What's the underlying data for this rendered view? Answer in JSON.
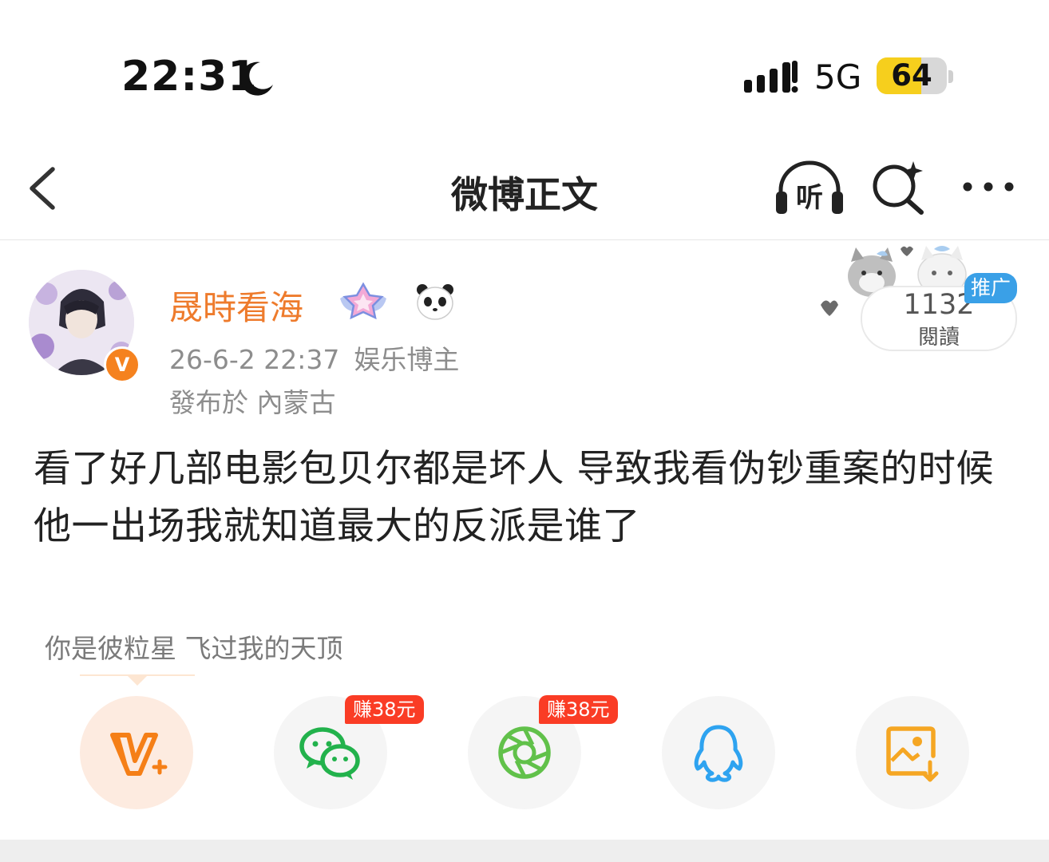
{
  "status_bar": {
    "time": "22:31",
    "network": "5G",
    "battery": "64",
    "battery_level_percent": 64,
    "moon_icon": "moon-icon",
    "signal_icon": "signal-icon"
  },
  "nav": {
    "title": "微博正文",
    "listen_label": "听",
    "back_icon": "chevron-left-icon",
    "search_icon": "ai-search-icon",
    "more_icon": "more-icon"
  },
  "post": {
    "username": "晟時看海",
    "date": "26-6-2 22:37",
    "role": "娱乐博主",
    "location": "發布於 內蒙古",
    "verified_badge": "V",
    "text": "看了好几部电影包贝尔都是坏人 导致我看伪钞重案的时候他一出场我就知道最大的反派是谁了"
  },
  "reads": {
    "count": "1132",
    "label": "閱讀",
    "promo_tag": "推广"
  },
  "share": {
    "title": "你是彼粒星 飞过我的天顶",
    "reward_wechat": "赚38元",
    "reward_moments": "赚38元",
    "items": [
      "vplus-icon",
      "wechat-icon",
      "moments-icon",
      "qq-icon",
      "save-image-icon"
    ]
  },
  "colors": {
    "username": "#ee7b2c",
    "verified": "#f5821f",
    "reward": "#fa3c25",
    "promo": "#3aa0e7",
    "wechat": "#22b24c",
    "moments": "#61c14a",
    "qq": "#2ea3f0",
    "save": "#f5a623"
  }
}
